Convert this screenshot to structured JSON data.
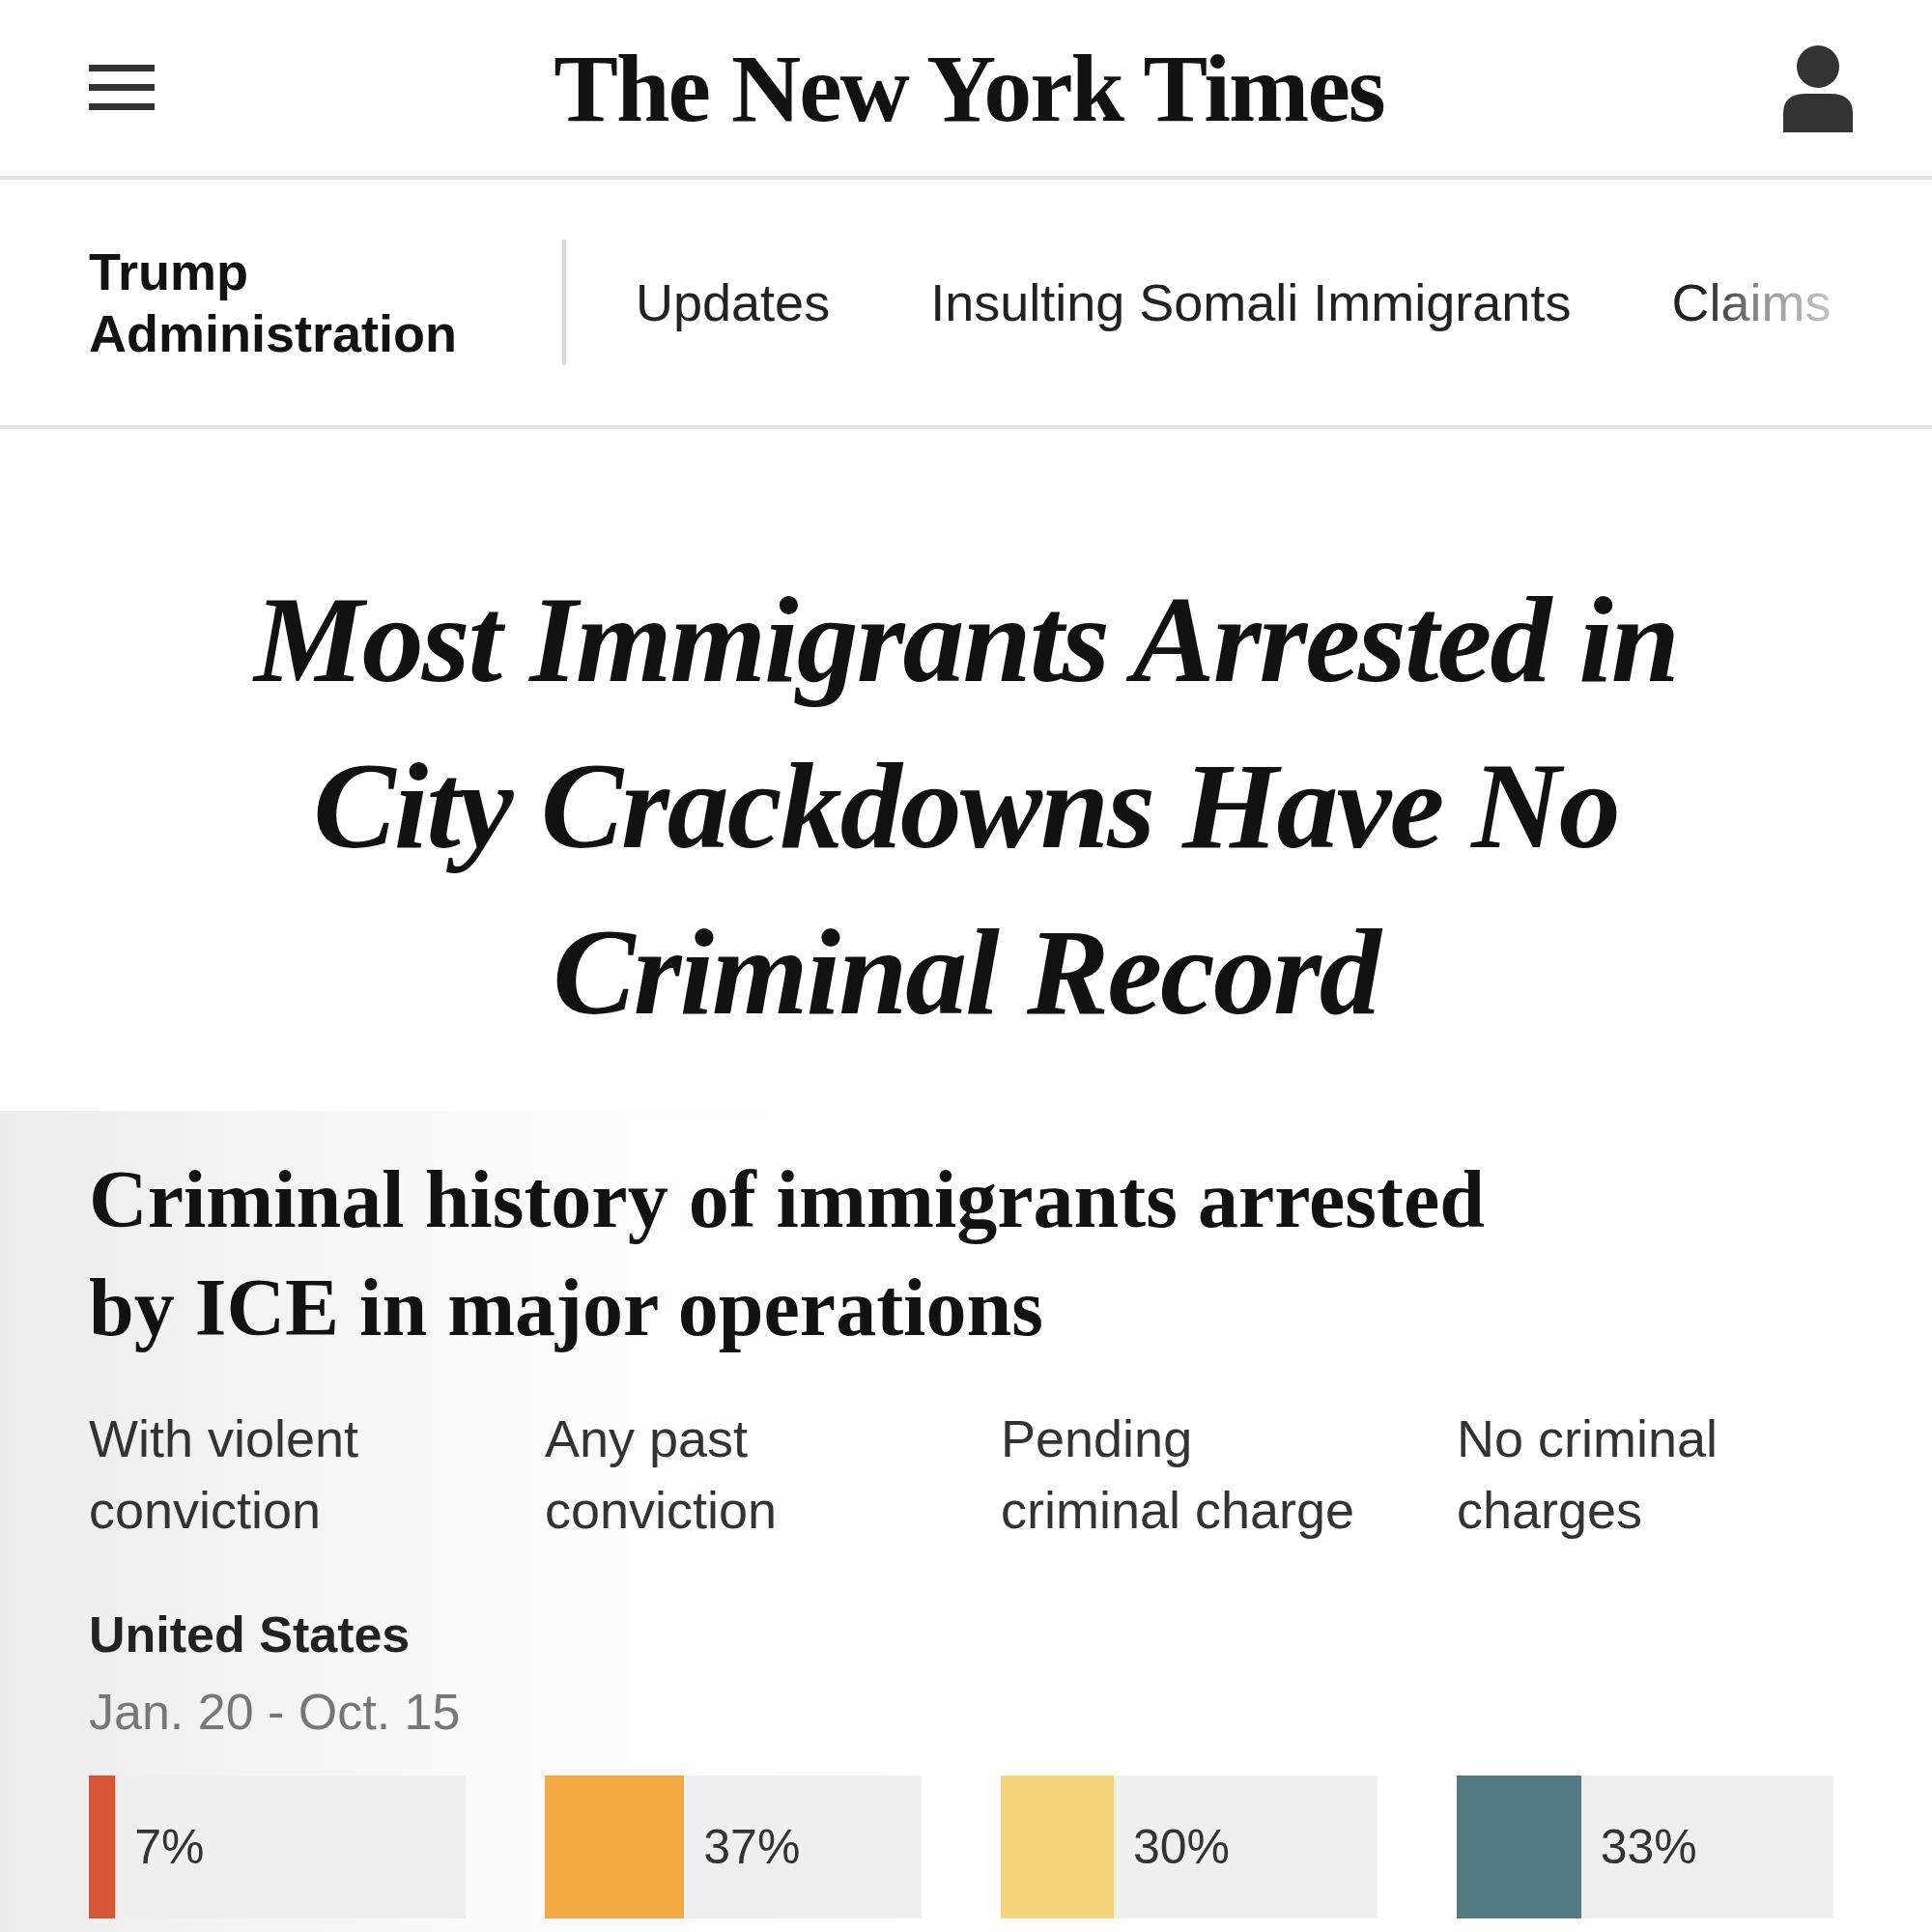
{
  "header": {
    "logo": "The New York Times"
  },
  "section_nav": {
    "section": "Trump Administration",
    "items": [
      {
        "label": "Updates"
      },
      {
        "label": "Insulting Somali Immigrants"
      },
      {
        "label": "Claims"
      }
    ]
  },
  "headline": "Most Immigrants Arrested in City Crackdowns Have No Criminal Record",
  "graphic": {
    "title": "Criminal history of immigrants arrested by ICE in major operations",
    "columns": [
      "With violent conviction",
      "Any past conviction",
      "Pending criminal charge",
      "No criminal charges"
    ],
    "region": "United States",
    "period": "Jan. 20 - Oct. 15",
    "bars": [
      {
        "level": 0.07,
        "reading": "7%",
        "color": "#d9553a"
      },
      {
        "level": 0.37,
        "reading": "37%",
        "color": "#f4a843"
      },
      {
        "level": 0.3,
        "reading": "30%",
        "color": "#f6d47a"
      },
      {
        "level": 0.33,
        "reading": "33%",
        "color": "#527a82"
      }
    ]
  }
}
